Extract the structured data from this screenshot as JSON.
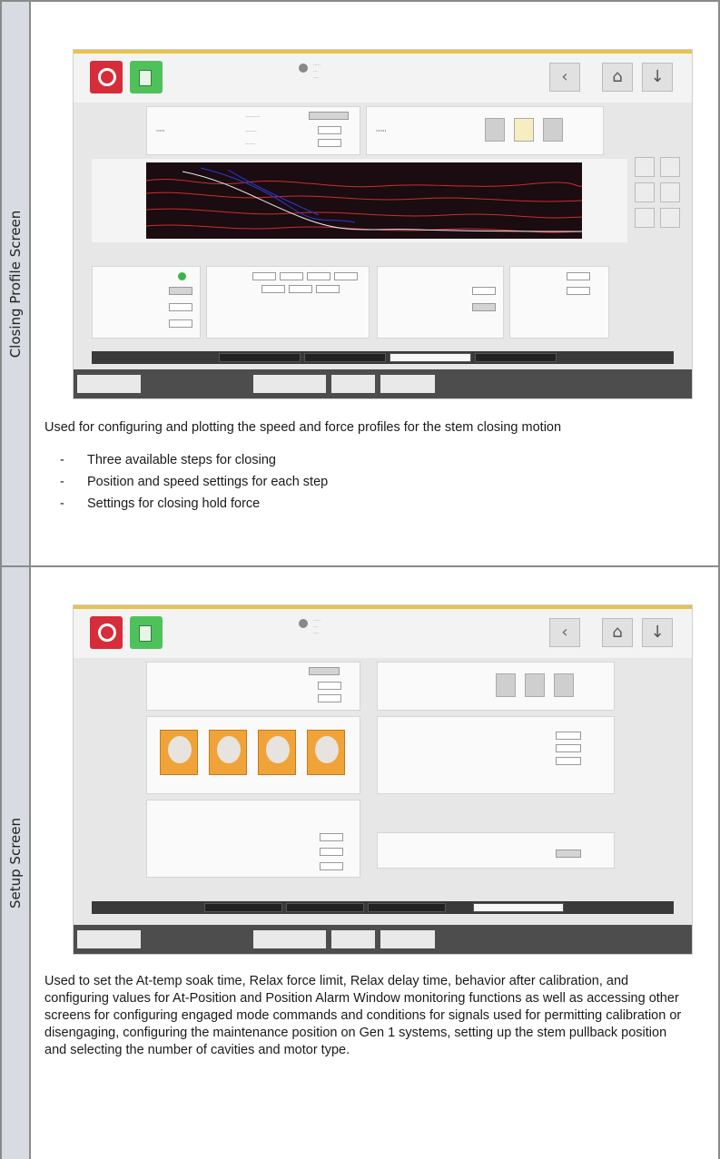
{
  "sections": [
    {
      "label": "Closing Profile Screen",
      "description": "Used for configuring and plotting the speed and force profiles for the stem closing motion",
      "bullets": [
        "Three available steps for closing",
        "Position and speed settings for each step",
        "Settings for closing hold force"
      ]
    },
    {
      "label": "Setup Screen",
      "description": "Used to set the At-temp soak time, Relax force limit, Relax delay time, behavior after calibration, and configuring values for At-Position and Position Alarm Window monitoring functions as well as accessing other screens for configuring engaged mode commands and conditions for signals used for permitting calibration or disengaging, configuring the maintenance position on Gen 1 systems, setting up the stem pullback position and selecting the number of cavities and motor type."
    }
  ],
  "colors": {
    "sidebar": "#d9dbe3",
    "border": "#8a8a8a",
    "accent_red": "#d72c3a",
    "accent_green": "#4fc15a",
    "accent_orange": "#f0a338"
  },
  "icons": {
    "back": "chevron-left-icon",
    "home": "home-icon",
    "down": "arrow-down-icon"
  }
}
